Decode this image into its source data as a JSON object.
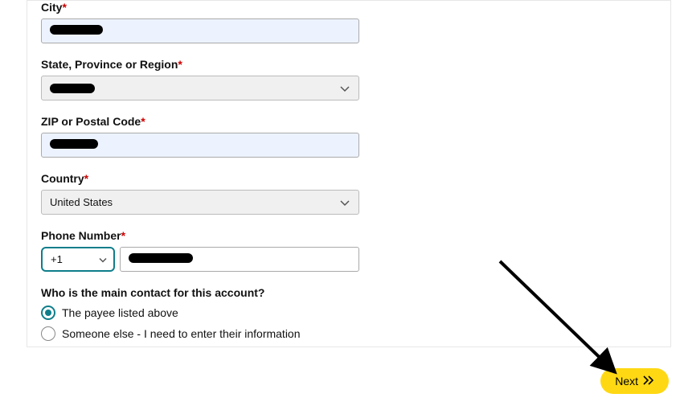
{
  "form": {
    "city": {
      "label": "City",
      "required": "*",
      "value": ""
    },
    "state": {
      "label": "State, Province or Region",
      "required": "*",
      "value": ""
    },
    "zip": {
      "label": "ZIP or Postal Code",
      "required": "*",
      "value": ""
    },
    "country": {
      "label": "Country",
      "required": "*",
      "value": "United States"
    },
    "phone": {
      "label": "Phone Number",
      "required": "*",
      "code": "+1",
      "number": ""
    },
    "contact": {
      "question": "Who is the main contact for this account?",
      "option1": "The payee listed above",
      "option2": "Someone else - I need to enter their information",
      "selected": 1
    }
  },
  "next_label": "Next"
}
